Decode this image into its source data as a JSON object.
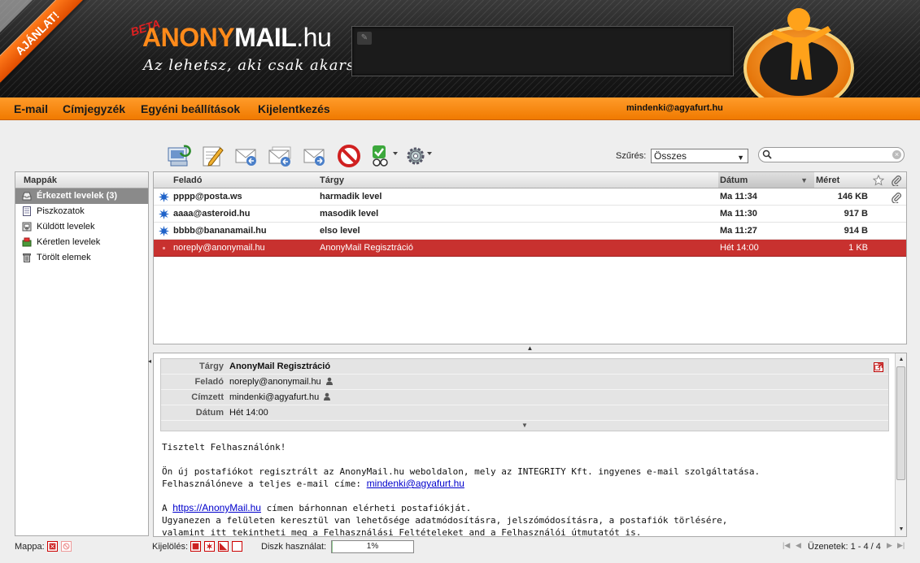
{
  "header": {
    "ribbon": "AJÁNLAT!",
    "beta": "BETA",
    "logo_anony": "ANONY",
    "logo_mail": "MAIL",
    "logo_hu": ".hu",
    "slogan": "Az lehetsz, aki csak akarsz!"
  },
  "nav": {
    "items": [
      "E-mail",
      "Címjegyzék",
      "Egyéni beállítások",
      "Kijelentkezés"
    ],
    "user": "mindenki@agyafurt.hu"
  },
  "toolbar": {
    "filter_label": "Szűrés:",
    "filter_value": "Összes"
  },
  "folders": {
    "title": "Mappák",
    "items": [
      {
        "label": "Érkezett levelek (3)",
        "icon": "inbox-icon",
        "selected": true
      },
      {
        "label": "Piszkozatok",
        "icon": "drafts-icon"
      },
      {
        "label": "Küldött levelek",
        "icon": "sent-icon"
      },
      {
        "label": "Kéretlen levelek",
        "icon": "junk-icon"
      },
      {
        "label": "Törölt elemek",
        "icon": "trash-icon"
      }
    ]
  },
  "list": {
    "columns": {
      "from": "Feladó",
      "subject": "Tárgy",
      "date": "Dátum",
      "size": "Méret"
    },
    "rows": [
      {
        "from": "pppp@posta.ws",
        "subject": "harmadik level",
        "date": "Ma 11:34",
        "size": "146 KB",
        "unread": true,
        "attachment": true
      },
      {
        "from": "aaaa@asteroid.hu",
        "subject": "masodik level",
        "date": "Ma 11:30",
        "size": "917 B",
        "unread": true
      },
      {
        "from": "bbbb@bananamail.hu",
        "subject": "elso level",
        "date": "Ma 11:27",
        "size": "914 B",
        "unread": true
      },
      {
        "from": "noreply@anonymail.hu",
        "subject": "AnonyMail Regisztráció",
        "date": "Hét 14:00",
        "size": "1 KB",
        "selected": true
      }
    ]
  },
  "preview": {
    "labels": {
      "subject": "Tárgy",
      "from": "Feladó",
      "to": "Címzett",
      "date": "Dátum"
    },
    "subject": "AnonyMail Regisztráció",
    "from": "noreply@anonymail.hu",
    "to": "mindenki@agyafurt.hu",
    "date": "Hét 14:00",
    "body": {
      "greeting": "Tisztelt Felhasználónk!",
      "line1": "Ön új postafiókot regisztrált az AnonyMail.hu weboldalon, mely az INTEGRITY Kft. ingyenes e-mail szolgáltatása.",
      "line2_pre": "Felhasználóneve a teljes e-mail címe: ",
      "line2_link": "mindenki@agyafurt.hu",
      "line3_pre": "A ",
      "line3_link": "https://AnonyMail.hu",
      "line3_post": " címen bárhonnan elérheti postafiókját.",
      "line4": "Ugyanezen a felületen keresztül van lehetősége adatmódosításra, jelszómódosításra, a postafiók törlésére,",
      "line5": "valamint itt tekintheti meg a Felhasználási Feltételeket and a Felhasználói útmutatót is."
    }
  },
  "footer": {
    "folder_label": "Mappa:",
    "select_label": "Kijelölés:",
    "quota_label": "Diszk használat:",
    "quota_value": "1%",
    "quota_fraction": 0.01,
    "messages": "Üzenetek: 1 - 4 / 4"
  },
  "colors": {
    "accent": "#f28a14",
    "selected_row": "#c8312f"
  }
}
